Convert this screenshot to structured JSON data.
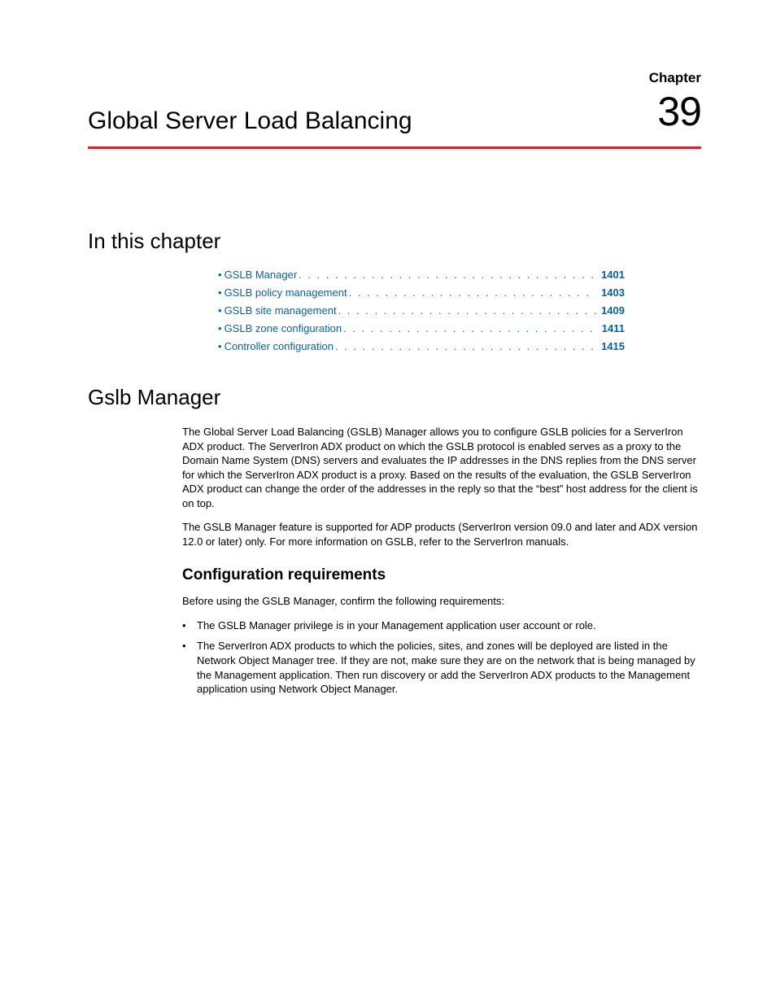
{
  "chapter": {
    "label": "Chapter",
    "number": "39",
    "title": "Global Server Load Balancing"
  },
  "sections": {
    "inThisChapter": "In this chapter",
    "gslbManager": "Gslb Manager",
    "configReq": "Configuration requirements"
  },
  "toc": [
    {
      "label": "GSLB Manager",
      "page": "1401"
    },
    {
      "label": "GSLB policy management",
      "page": "1403"
    },
    {
      "label": "GSLB site management",
      "page": "1409"
    },
    {
      "label": "GSLB zone configuration",
      "page": "1411"
    },
    {
      "label": "Controller configuration",
      "page": "1415"
    }
  ],
  "body": {
    "p1": "The Global Server Load Balancing (GSLB) Manager allows you to configure GSLB policies for a ServerIron ADX product. The ServerIron ADX product on which the GSLB protocol is enabled serves as a proxy to the Domain Name System (DNS) servers and evaluates the IP addresses in the DNS replies from the DNS server for which the ServerIron ADX product is a proxy. Based on the results of the evaluation, the GSLB ServerIron ADX product can change the order of the addresses in the reply so that the “best” host address for the client is on top.",
    "p2": "The GSLB Manager feature is supported for ADP products (ServerIron version 09.0 and later and ADX version 12.0 or later) only. For more information on GSLB, refer to the ServerIron manuals.",
    "p3": "Before using the GSLB Manager, confirm the following requirements:",
    "b1": "The GSLB Manager privilege is in your Management application user account or role.",
    "b2": "The ServerIron ADX products to which the policies, sites, and zones will be deployed are listed in the Network Object Manager tree. If they are not, make sure they are on the network that is being managed by the Management application. Then run discovery or add the ServerIron ADX products to the Management application using Network Object Manager."
  },
  "dots": ". . . . . . . . . . . . . . . . . . . . . . . . . . . . . . . . . . . . . . . . . . . . . . . . . . . . . . . . . . . . . . . ."
}
